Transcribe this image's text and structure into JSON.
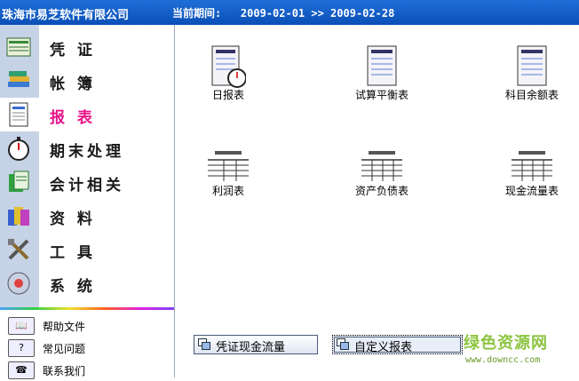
{
  "header": {
    "company": "珠海市易芝软件有限公司",
    "period": "当前期间:   2009-02-01 >> 2009-02-28"
  },
  "nav": {
    "items": [
      {
        "label": "凭 证",
        "icon": "voucher-icon"
      },
      {
        "label": "帐 簿",
        "icon": "ledger-books-icon"
      },
      {
        "label": "报 表",
        "icon": "report-icon",
        "active": true
      },
      {
        "label": "期末处理",
        "icon": "stopwatch-icon"
      },
      {
        "label": "会计相关",
        "icon": "accounting-icon"
      },
      {
        "label": "资 料",
        "icon": "data-cards-icon"
      },
      {
        "label": "工 具",
        "icon": "tools-icon"
      },
      {
        "label": "系 统",
        "icon": "system-icon"
      }
    ],
    "active_color": "#e8128a"
  },
  "help": {
    "items": [
      {
        "label": "帮助文件",
        "icon": "help-book-icon"
      },
      {
        "label": "常见问题",
        "icon": "question-icon"
      },
      {
        "label": "联系我们",
        "icon": "phone-icon"
      }
    ]
  },
  "reports": {
    "items": [
      {
        "label": "日报表",
        "icon": "daily-report-icon"
      },
      {
        "label": "试算平衡表",
        "icon": "trial-balance-icon"
      },
      {
        "label": "科目余额表",
        "icon": "account-balance-icon"
      },
      {
        "label": "利润表",
        "icon": "profit-statement-icon"
      },
      {
        "label": "资产负债表",
        "icon": "balance-sheet-icon"
      },
      {
        "label": "现金流量表",
        "icon": "cash-flow-icon"
      }
    ]
  },
  "buttons": {
    "cash_flow_voucher": "凭证现金流量",
    "custom_report": "自定义报表"
  },
  "watermark": {
    "name": "绿色资源网",
    "url": "www.downcc.com"
  },
  "colors": {
    "header_bg": "#0a4fb7",
    "sidebar_strip": "#c6d3e6"
  }
}
